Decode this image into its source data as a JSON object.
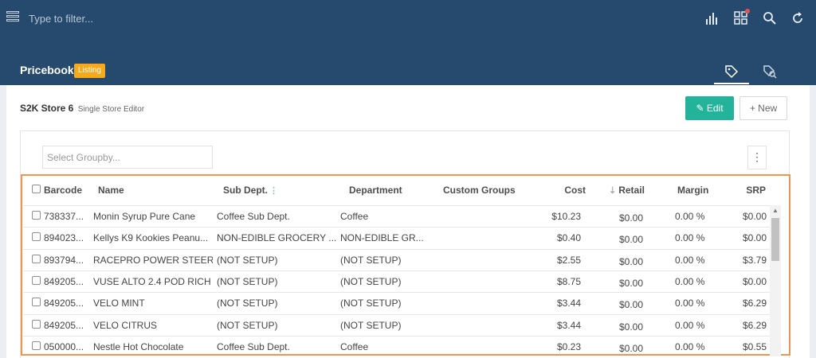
{
  "topbar": {
    "filter_placeholder": "Type to filter...",
    "icons": [
      "menu-icon",
      "bar-chart-icon",
      "grid-icon",
      "search-icon",
      "refresh-icon"
    ],
    "notification_color": "#e8524a"
  },
  "header": {
    "title": "Pricebook",
    "badge": "Listing",
    "tabs": [
      "tag-icon",
      "search-tag-icon"
    ]
  },
  "store": {
    "name": "S2K Store 6",
    "subtitle": "Single Store Editor"
  },
  "actions": {
    "edit_label": "Edit",
    "new_label": "New"
  },
  "groupby": {
    "placeholder": "Select Groupby..."
  },
  "table": {
    "columns": {
      "barcode": "Barcode",
      "name": "Name",
      "subdept": "Sub Dept.",
      "department": "Department",
      "custom_groups": "Custom Groups",
      "cost": "Cost",
      "retail": "Retail",
      "margin": "Margin",
      "srp": "SRP"
    },
    "rows": [
      {
        "barcode": "738337...",
        "name": "Monin Syrup Pure Cane",
        "subdept": "Coffee Sub Dept.",
        "department": "Coffee",
        "custom_groups": "",
        "cost": "$10.23",
        "retail": "$0.00",
        "margin": "0.00 %",
        "srp": "$0.00"
      },
      {
        "barcode": "894023...",
        "name": "Kellys K9 Kookies Peanu...",
        "subdept": "NON-EDIBLE GROCERY ...",
        "department": "NON-EDIBLE GR...",
        "custom_groups": "",
        "cost": "$0.40",
        "retail": "$0.00",
        "margin": "0.00 %",
        "srp": "$0.00"
      },
      {
        "barcode": "893794...",
        "name": "RACEPRO POWER STEER...",
        "subdept": "(NOT SETUP)",
        "department": "(NOT SETUP)",
        "custom_groups": "",
        "cost": "$2.55",
        "retail": "$0.00",
        "margin": "0.00 %",
        "srp": "$3.79"
      },
      {
        "barcode": "849205...",
        "name": "VUSE ALTO 2.4 POD RICH",
        "subdept": "(NOT SETUP)",
        "department": "(NOT SETUP)",
        "custom_groups": "",
        "cost": "$8.75",
        "retail": "$0.00",
        "margin": "0.00 %",
        "srp": "$0.00"
      },
      {
        "barcode": "849205...",
        "name": "VELO MINT",
        "subdept": "(NOT SETUP)",
        "department": "(NOT SETUP)",
        "custom_groups": "",
        "cost": "$3.44",
        "retail": "$0.00",
        "margin": "0.00 %",
        "srp": "$6.29"
      },
      {
        "barcode": "849205...",
        "name": "VELO CITRUS",
        "subdept": "(NOT SETUP)",
        "department": "(NOT SETUP)",
        "custom_groups": "",
        "cost": "$3.44",
        "retail": "$0.00",
        "margin": "0.00 %",
        "srp": "$6.29"
      },
      {
        "barcode": "050000...",
        "name": "Nestle Hot Chocolate",
        "subdept": "Coffee Sub Dept.",
        "department": "Coffee",
        "custom_groups": "",
        "cost": "$0.23",
        "retail": "$0.00",
        "margin": "0.00 %",
        "srp": "$0.55"
      }
    ]
  },
  "colors": {
    "topbar": "#264a6e",
    "edit_button": "#23b39a",
    "badge": "#f7a91c",
    "highlight": "#f0954a"
  }
}
